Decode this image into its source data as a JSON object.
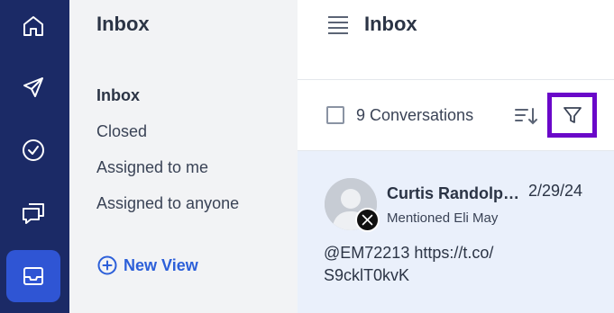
{
  "nav": {
    "items": [
      {
        "icon": "home-icon",
        "active": false
      },
      {
        "icon": "send-icon",
        "active": false
      },
      {
        "icon": "check-circle-icon",
        "active": false
      },
      {
        "icon": "chat-icon",
        "active": false
      },
      {
        "icon": "inbox-icon",
        "active": true
      }
    ]
  },
  "sidebar": {
    "title": "Inbox",
    "folders": [
      "Inbox",
      "Closed",
      "Assigned to me",
      "Assigned to anyone"
    ],
    "new_view_label": "New View"
  },
  "main": {
    "title": "Inbox",
    "toolbar": {
      "count_label": "9 Conversations"
    },
    "conversation": {
      "sender": "Curtis Randolph Jr.",
      "date": "2/29/24",
      "subline": "Mentioned Eli May",
      "channel_icon": "x-logo-icon",
      "preview": "@EM72213 https://t.co/ S9cklT0kvK"
    }
  },
  "colors": {
    "rail_bg": "#1b2a66",
    "rail_active": "#2f55d4",
    "accent": "#2c5fd9",
    "highlight_border": "#6a08c9",
    "card_bg": "#eaf0fb"
  }
}
